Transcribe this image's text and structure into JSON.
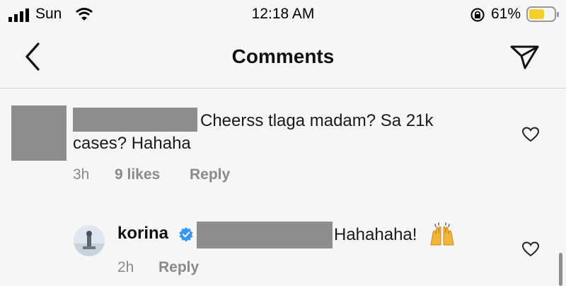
{
  "status_bar": {
    "carrier": "Sun",
    "time": "12:18 AM",
    "battery_percent": "61%",
    "signal_bars": 4,
    "battery_level": 0.61,
    "battery_color": "#f5cf2b",
    "icons": [
      "signal-icon",
      "wifi-icon",
      "orientation-lock-icon",
      "battery-icon"
    ]
  },
  "header": {
    "title": "Comments",
    "back_icon": "back-chevron-icon",
    "share_icon": "send-icon"
  },
  "comments": [
    {
      "username_redacted": true,
      "text_line1": "Cheerss tlaga madam? Sa 21k",
      "text_line2": "cases? Hahaha",
      "time": "3h",
      "likes": "9 likes",
      "reply_label": "Reply"
    },
    {
      "username": "korina",
      "verified": true,
      "text": "Hahahaha!",
      "emoji": "raising-hands",
      "time": "2h",
      "reply_label": "Reply"
    }
  ]
}
